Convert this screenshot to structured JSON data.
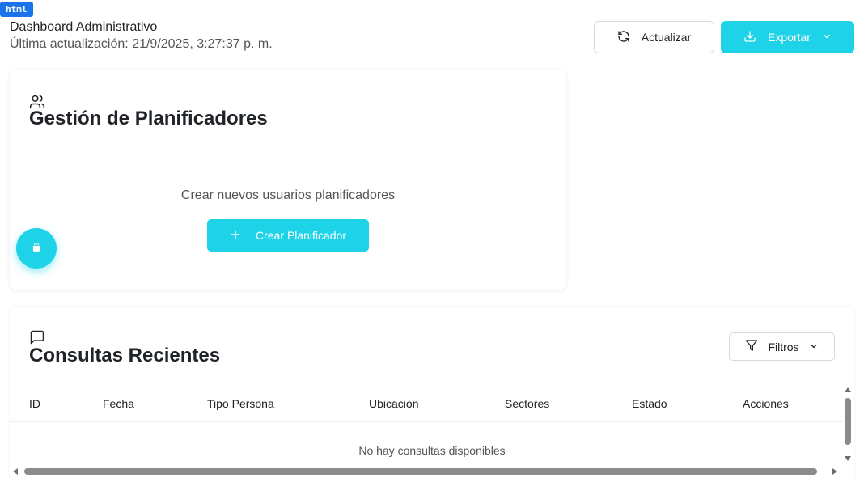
{
  "dev_badge": "html",
  "header": {
    "title": "Dashboard Administrativo",
    "last_update": "Última actualización: 21/9/2025, 3:27:37 p. m.",
    "refresh_label": "Actualizar",
    "export_label": "Exportar"
  },
  "planners": {
    "title": "Gestión de Planificadores",
    "description": "Crear nuevos usuarios planificadores",
    "create_label": "Crear Planificador"
  },
  "consultations": {
    "title": "Consultas Recientes",
    "filter_label": "Filtros",
    "columns": [
      "ID",
      "Fecha",
      "Tipo Persona",
      "Ubicación",
      "Sectores",
      "Estado",
      "Acciones"
    ],
    "empty_message": "No hay consultas disponibles"
  },
  "icons": {
    "refresh": "refresh-icon",
    "download": "download-icon",
    "chevron": "chevron-down-icon",
    "users": "users-icon",
    "plus": "plus-icon",
    "chat": "message-square-icon",
    "filter": "filter-icon",
    "fab": "assistant-icon"
  },
  "colors": {
    "accent": "#1ed3e8",
    "badge": "#1a73e8"
  }
}
